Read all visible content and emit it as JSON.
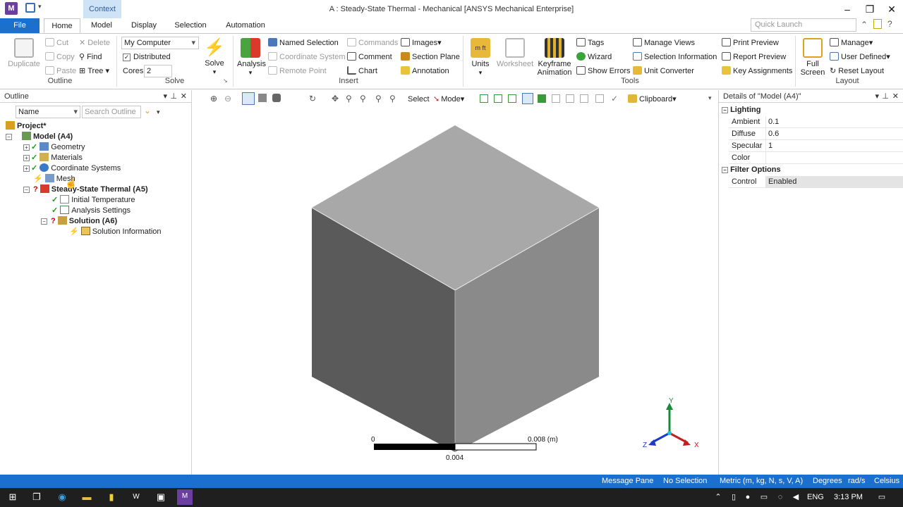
{
  "app": {
    "title": "A : Steady-State Thermal - Mechanical [ANSYS Mechanical Enterprise]",
    "icon_letter": "M",
    "context_tab": "Context",
    "quick_launch_placeholder": "Quick Launch"
  },
  "tabs": [
    "File",
    "Home",
    "Model",
    "Display",
    "Selection",
    "Automation"
  ],
  "ribbon": {
    "outline": {
      "group": "Outline",
      "duplicate": "Duplicate",
      "cut": "Cut",
      "copy": "Copy",
      "paste": "Paste",
      "delete": "Delete",
      "find": "Find",
      "tree": "Tree"
    },
    "solve": {
      "group": "Solve",
      "computer": "My Computer",
      "distributed": "Distributed",
      "cores_label": "Cores",
      "cores_value": "2",
      "solve": "Solve"
    },
    "insert": {
      "group": "Insert",
      "analysis": "Analysis",
      "named_selection": "Named Selection",
      "coordinate_system": "Coordinate System",
      "remote_point": "Remote Point",
      "commands": "Commands",
      "comment": "Comment",
      "chart": "Chart",
      "images": "Images",
      "section_plane": "Section Plane",
      "annotation": "Annotation"
    },
    "tools": {
      "group": "Tools",
      "units": "Units",
      "worksheet": "Worksheet",
      "keyframe": "Keyframe Animation",
      "tags": "Tags",
      "wizard": "Wizard",
      "show_errors": "Show Errors",
      "manage_views": "Manage Views",
      "selection_information": "Selection Information",
      "unit_converter": "Unit Converter",
      "print_preview": "Print Preview",
      "report_preview": "Report Preview",
      "key_assignments": "Key Assignments"
    },
    "layout": {
      "group": "Layout",
      "full_screen": "Full Screen",
      "manage": "Manage",
      "user_defined": "User Defined",
      "reset_layout": "Reset Layout"
    }
  },
  "outline": {
    "title": "Outline",
    "filter_name": "Name",
    "search_placeholder": "Search Outline",
    "tree": [
      {
        "label": "Project*"
      },
      {
        "label": "Model (A4)"
      },
      {
        "label": "Geometry"
      },
      {
        "label": "Materials"
      },
      {
        "label": "Coordinate Systems"
      },
      {
        "label": "Mesh"
      },
      {
        "label": "Steady-State Thermal (A5)"
      },
      {
        "label": "Initial Temperature"
      },
      {
        "label": "Analysis Settings"
      },
      {
        "label": "Solution (A6)"
      },
      {
        "label": "Solution Information"
      }
    ]
  },
  "graphics_toolbar": {
    "select": "Select",
    "mode": "Mode",
    "clipboard": "Clipboard"
  },
  "viewport": {
    "scale_start": "0",
    "scale_mid": "0.004",
    "scale_end": "0.008 (m)",
    "axis_x": "X",
    "axis_y": "Y",
    "axis_z": "Z"
  },
  "details": {
    "title": "Details of \"Model (A4)\"",
    "sections": [
      {
        "name": "Lighting",
        "rows": [
          {
            "key": "Ambient",
            "value": "0.1"
          },
          {
            "key": "Diffuse",
            "value": "0.6"
          },
          {
            "key": "Specular",
            "value": "1"
          },
          {
            "key": "Color",
            "value": ""
          }
        ]
      },
      {
        "name": "Filter Options",
        "rows": [
          {
            "key": "Control",
            "value": "Enabled"
          }
        ]
      }
    ]
  },
  "status": {
    "message_pane": "Message Pane",
    "selection": "No Selection",
    "units": "Metric (m, kg, N, s, V, A)",
    "angle": "Degrees",
    "rate": "rad/s",
    "temp": "Celsius"
  },
  "taskbar": {
    "language": "ENG",
    "time": "3:13 PM"
  },
  "colors": {
    "accent": "#1a6fcf",
    "cube_top": "#a8a8a8",
    "cube_left": "#5a5a5a",
    "cube_right": "#8a8a8a"
  }
}
